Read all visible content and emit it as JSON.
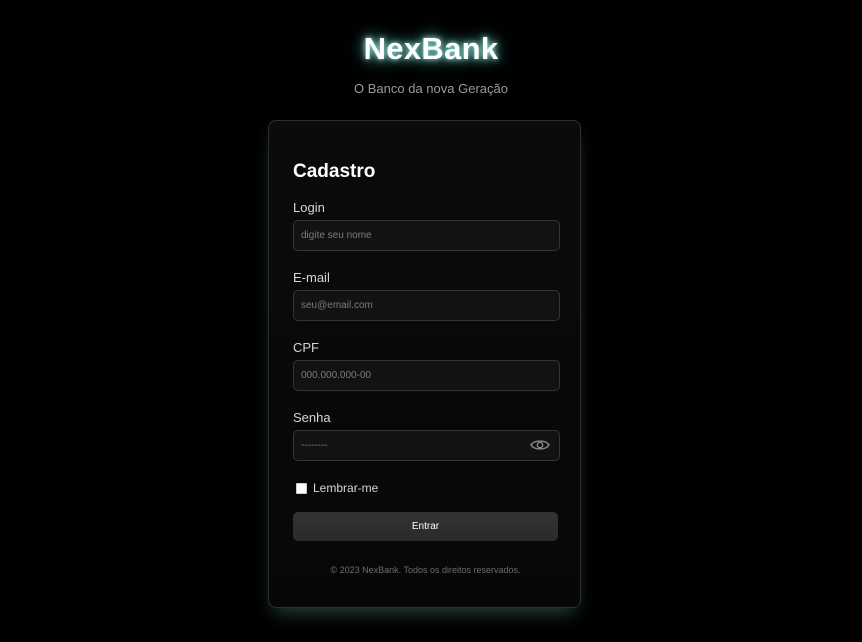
{
  "brand": {
    "name": "NexBank",
    "tagline": "O Banco da nova Geração"
  },
  "form": {
    "title": "Cadastro",
    "fields": {
      "login": {
        "label": "Login",
        "placeholder": "digite seu nome",
        "value": ""
      },
      "email": {
        "label": "E-mail",
        "placeholder": "seu@email.com",
        "value": ""
      },
      "cpf": {
        "label": "CPF",
        "placeholder": "000.000.000-00",
        "value": ""
      },
      "password": {
        "label": "Senha",
        "placeholder": "--------",
        "value": "",
        "toggle_icon": "eye-icon"
      }
    },
    "remember_label": "Lembrar-me",
    "remember_checked": false,
    "submit_label": "Entrar",
    "footer": "© 2023 NexBank. Todos os direitos reservados."
  },
  "colors": {
    "background": "#000000",
    "card": "#0a0a0a",
    "brand_glow": "#7fe3d6",
    "button": "#2e2e2e"
  }
}
